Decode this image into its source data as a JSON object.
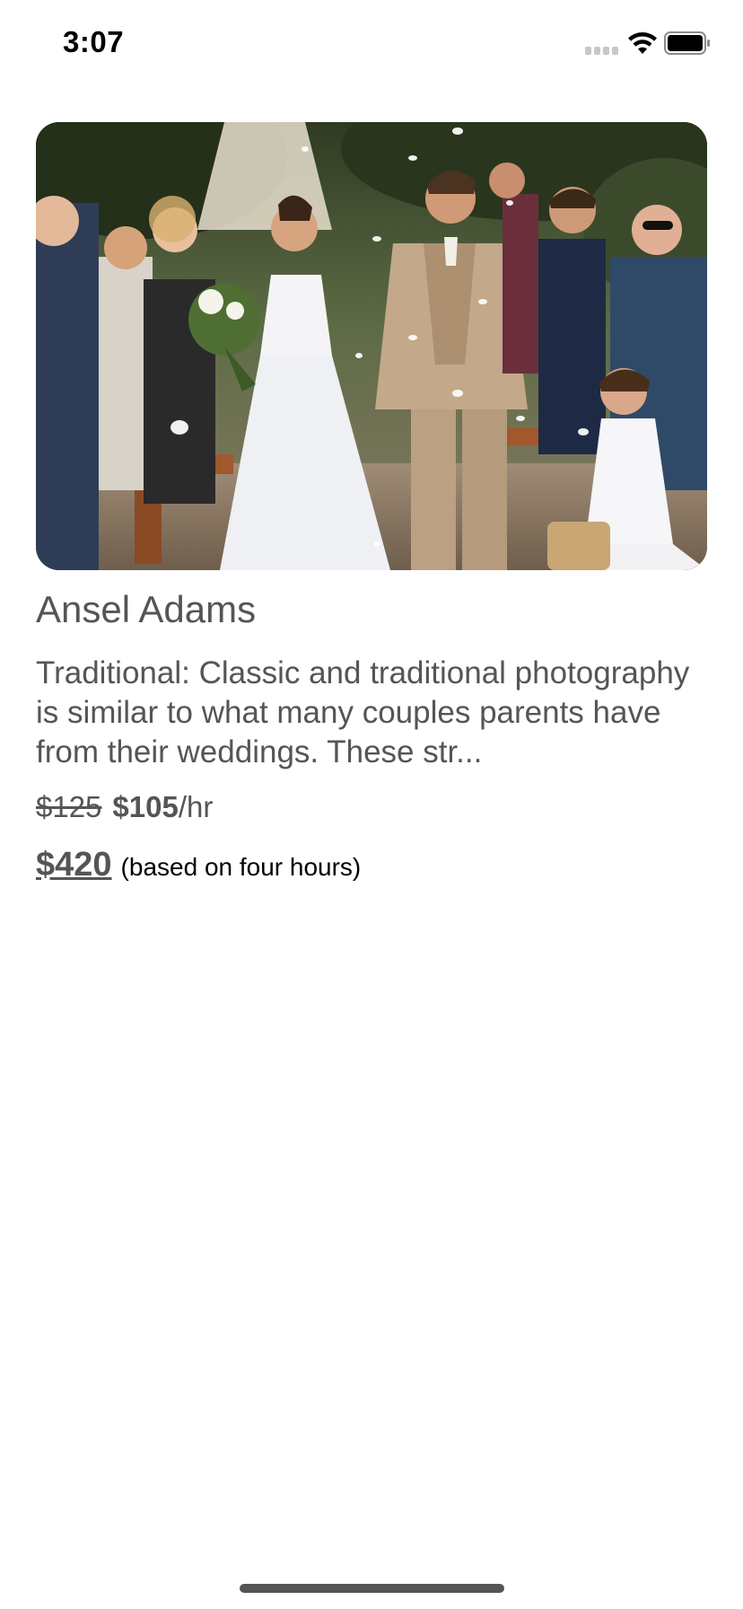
{
  "status_bar": {
    "time": "3:07"
  },
  "listing": {
    "image_alt": "Wedding couple walking down the aisle with guests tossing petals",
    "name": "Ansel Adams",
    "description": "Traditional: Classic and traditional photography is similar to what many couples parents have from their weddings. These str...",
    "old_price": "$125",
    "new_price": "$105",
    "price_unit": "/hr",
    "total": "$420",
    "total_note": "(based on four hours)"
  },
  "colors": {
    "text_primary": "#555555",
    "text_note": "#000000",
    "home_indicator": "#555555"
  }
}
